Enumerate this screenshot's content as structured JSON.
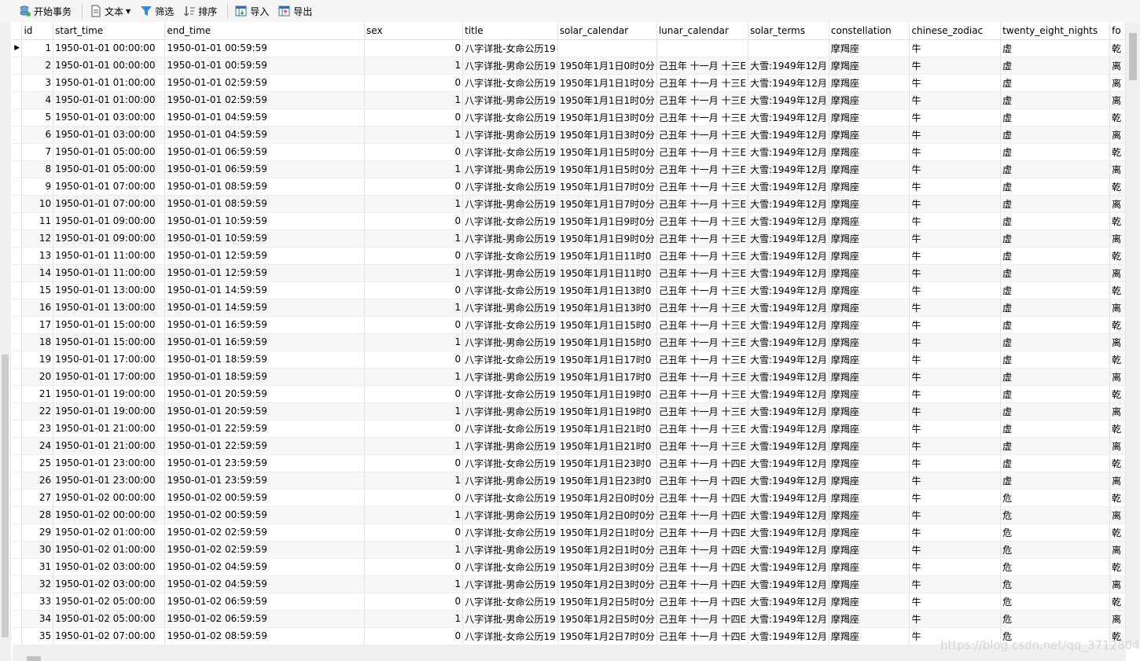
{
  "toolbar": {
    "begin_transaction": "开始事务",
    "text": "文本",
    "filter": "筛选",
    "sort": "排序",
    "import": "导入",
    "export": "导出"
  },
  "table": {
    "columns": [
      "id",
      "start_time",
      "end_time",
      "sex",
      "title",
      "solar_calendar",
      "lunar_calendar",
      "solar_terms",
      "constellation",
      "chinese_zodiac",
      "twenty_eight_nights",
      "fo"
    ],
    "rows": [
      [
        "1",
        "1950-01-01 00:00:00",
        "1950-01-01 00:59:59",
        "0",
        "八字详批-女命公历19",
        "",
        "",
        "",
        "摩羯座",
        "牛",
        "虚",
        "乾"
      ],
      [
        "2",
        "1950-01-01 00:00:00",
        "1950-01-01 00:59:59",
        "1",
        "八字详批-男命公历19",
        "1950年1月1日0时0分",
        "己丑年 十一月 十三E",
        "大雪:1949年12月",
        "摩羯座",
        "牛",
        "虚",
        "离"
      ],
      [
        "3",
        "1950-01-01 01:00:00",
        "1950-01-01 02:59:59",
        "0",
        "八字详批-女命公历19",
        "1950年1月1日1时0分",
        "己丑年 十一月 十三E",
        "大雪:1949年12月",
        "摩羯座",
        "牛",
        "虚",
        "离"
      ],
      [
        "4",
        "1950-01-01 01:00:00",
        "1950-01-01 02:59:59",
        "1",
        "八字详批-男命公历19",
        "1950年1月1日1时0分",
        "己丑年 十一月 十三E",
        "大雪:1949年12月",
        "摩羯座",
        "牛",
        "虚",
        "离"
      ],
      [
        "5",
        "1950-01-01 03:00:00",
        "1950-01-01 04:59:59",
        "0",
        "八字详批-女命公历19",
        "1950年1月1日3时0分",
        "己丑年 十一月 十三E",
        "大雪:1949年12月",
        "摩羯座",
        "牛",
        "虚",
        "乾"
      ],
      [
        "6",
        "1950-01-01 03:00:00",
        "1950-01-01 04:59:59",
        "1",
        "八字详批-男命公历19",
        "1950年1月1日3时0分",
        "己丑年 十一月 十三E",
        "大雪:1949年12月",
        "摩羯座",
        "牛",
        "虚",
        "离"
      ],
      [
        "7",
        "1950-01-01 05:00:00",
        "1950-01-01 06:59:59",
        "0",
        "八字详批-女命公历19",
        "1950年1月1日5时0分",
        "己丑年 十一月 十三E",
        "大雪:1949年12月",
        "摩羯座",
        "牛",
        "虚",
        "乾"
      ],
      [
        "8",
        "1950-01-01 05:00:00",
        "1950-01-01 06:59:59",
        "1",
        "八字详批-男命公历19",
        "1950年1月1日5时0分",
        "己丑年 十一月 十三E",
        "大雪:1949年12月",
        "摩羯座",
        "牛",
        "虚",
        "离"
      ],
      [
        "9",
        "1950-01-01 07:00:00",
        "1950-01-01 08:59:59",
        "0",
        "八字详批-女命公历19",
        "1950年1月1日7时0分",
        "己丑年 十一月 十三E",
        "大雪:1949年12月",
        "摩羯座",
        "牛",
        "虚",
        "乾"
      ],
      [
        "10",
        "1950-01-01 07:00:00",
        "1950-01-01 08:59:59",
        "1",
        "八字详批-男命公历19",
        "1950年1月1日7时0分",
        "己丑年 十一月 十三E",
        "大雪:1949年12月",
        "摩羯座",
        "牛",
        "虚",
        "离"
      ],
      [
        "11",
        "1950-01-01 09:00:00",
        "1950-01-01 10:59:59",
        "0",
        "八字详批-女命公历19",
        "1950年1月1日9时0分",
        "己丑年 十一月 十三E",
        "大雪:1949年12月",
        "摩羯座",
        "牛",
        "虚",
        "乾"
      ],
      [
        "12",
        "1950-01-01 09:00:00",
        "1950-01-01 10:59:59",
        "1",
        "八字详批-男命公历19",
        "1950年1月1日9时0分",
        "己丑年 十一月 十三E",
        "大雪:1949年12月",
        "摩羯座",
        "牛",
        "虚",
        "离"
      ],
      [
        "13",
        "1950-01-01 11:00:00",
        "1950-01-01 12:59:59",
        "0",
        "八字详批-女命公历19",
        "1950年1月1日11时0",
        "己丑年 十一月 十三E",
        "大雪:1949年12月",
        "摩羯座",
        "牛",
        "虚",
        "乾"
      ],
      [
        "14",
        "1950-01-01 11:00:00",
        "1950-01-01 12:59:59",
        "1",
        "八字详批-男命公历19",
        "1950年1月1日11时0",
        "己丑年 十一月 十三E",
        "大雪:1949年12月",
        "摩羯座",
        "牛",
        "虚",
        "离"
      ],
      [
        "15",
        "1950-01-01 13:00:00",
        "1950-01-01 14:59:59",
        "0",
        "八字详批-女命公历19",
        "1950年1月1日13时0",
        "己丑年 十一月 十三E",
        "大雪:1949年12月",
        "摩羯座",
        "牛",
        "虚",
        "乾"
      ],
      [
        "16",
        "1950-01-01 13:00:00",
        "1950-01-01 14:59:59",
        "1",
        "八字详批-男命公历19",
        "1950年1月1日13时0",
        "己丑年 十一月 十三E",
        "大雪:1949年12月",
        "摩羯座",
        "牛",
        "虚",
        "离"
      ],
      [
        "17",
        "1950-01-01 15:00:00",
        "1950-01-01 16:59:59",
        "0",
        "八字详批-女命公历19",
        "1950年1月1日15时0",
        "己丑年 十一月 十三E",
        "大雪:1949年12月",
        "摩羯座",
        "牛",
        "虚",
        "乾"
      ],
      [
        "18",
        "1950-01-01 15:00:00",
        "1950-01-01 16:59:59",
        "1",
        "八字详批-男命公历19",
        "1950年1月1日15时0",
        "己丑年 十一月 十三E",
        "大雪:1949年12月",
        "摩羯座",
        "牛",
        "虚",
        "离"
      ],
      [
        "19",
        "1950-01-01 17:00:00",
        "1950-01-01 18:59:59",
        "0",
        "八字详批-女命公历19",
        "1950年1月1日17时0",
        "己丑年 十一月 十三E",
        "大雪:1949年12月",
        "摩羯座",
        "牛",
        "虚",
        "乾"
      ],
      [
        "20",
        "1950-01-01 17:00:00",
        "1950-01-01 18:59:59",
        "1",
        "八字详批-男命公历19",
        "1950年1月1日17时0",
        "己丑年 十一月 十三E",
        "大雪:1949年12月",
        "摩羯座",
        "牛",
        "虚",
        "离"
      ],
      [
        "21",
        "1950-01-01 19:00:00",
        "1950-01-01 20:59:59",
        "0",
        "八字详批-女命公历19",
        "1950年1月1日19时0",
        "己丑年 十一月 十三E",
        "大雪:1949年12月",
        "摩羯座",
        "牛",
        "虚",
        "乾"
      ],
      [
        "22",
        "1950-01-01 19:00:00",
        "1950-01-01 20:59:59",
        "1",
        "八字详批-男命公历19",
        "1950年1月1日19时0",
        "己丑年 十一月 十三E",
        "大雪:1949年12月",
        "摩羯座",
        "牛",
        "虚",
        "离"
      ],
      [
        "23",
        "1950-01-01 21:00:00",
        "1950-01-01 22:59:59",
        "0",
        "八字详批-女命公历19",
        "1950年1月1日21时0",
        "己丑年 十一月 十三E",
        "大雪:1949年12月",
        "摩羯座",
        "牛",
        "虚",
        "乾"
      ],
      [
        "24",
        "1950-01-01 21:00:00",
        "1950-01-01 22:59:59",
        "1",
        "八字详批-男命公历19",
        "1950年1月1日21时0",
        "己丑年 十一月 十三E",
        "大雪:1949年12月",
        "摩羯座",
        "牛",
        "虚",
        "离"
      ],
      [
        "25",
        "1950-01-01 23:00:00",
        "1950-01-01 23:59:59",
        "0",
        "八字详批-女命公历19",
        "1950年1月1日23时0",
        "己丑年 十一月 十四E",
        "大雪:1949年12月",
        "摩羯座",
        "牛",
        "虚",
        "乾"
      ],
      [
        "26",
        "1950-01-01 23:00:00",
        "1950-01-01 23:59:59",
        "1",
        "八字详批-男命公历19",
        "1950年1月1日23时0",
        "己丑年 十一月 十四E",
        "大雪:1949年12月",
        "摩羯座",
        "牛",
        "虚",
        "离"
      ],
      [
        "27",
        "1950-01-02 00:00:00",
        "1950-01-02 00:59:59",
        "0",
        "八字详批-女命公历19",
        "1950年1月2日0时0分",
        "己丑年 十一月 十四E",
        "大雪:1949年12月",
        "摩羯座",
        "牛",
        "危",
        "乾"
      ],
      [
        "28",
        "1950-01-02 00:00:00",
        "1950-01-02 00:59:59",
        "1",
        "八字详批-男命公历19",
        "1950年1月2日0时0分",
        "己丑年 十一月 十四E",
        "大雪:1949年12月",
        "摩羯座",
        "牛",
        "危",
        "离"
      ],
      [
        "29",
        "1950-01-02 01:00:00",
        "1950-01-02 02:59:59",
        "0",
        "八字详批-女命公历19",
        "1950年1月2日1时0分",
        "己丑年 十一月 十四E",
        "大雪:1949年12月",
        "摩羯座",
        "牛",
        "危",
        "乾"
      ],
      [
        "30",
        "1950-01-02 01:00:00",
        "1950-01-02 02:59:59",
        "1",
        "八字详批-男命公历19",
        "1950年1月2日1时0分",
        "己丑年 十一月 十四E",
        "大雪:1949年12月",
        "摩羯座",
        "牛",
        "危",
        "离"
      ],
      [
        "31",
        "1950-01-02 03:00:00",
        "1950-01-02 04:59:59",
        "0",
        "八字详批-女命公历19",
        "1950年1月2日3时0分",
        "己丑年 十一月 十四E",
        "大雪:1949年12月",
        "摩羯座",
        "牛",
        "危",
        "乾"
      ],
      [
        "32",
        "1950-01-02 03:00:00",
        "1950-01-02 04:59:59",
        "1",
        "八字详批-男命公历19",
        "1950年1月2日3时0分",
        "己丑年 十一月 十四E",
        "大雪:1949年12月",
        "摩羯座",
        "牛",
        "危",
        "离"
      ],
      [
        "33",
        "1950-01-02 05:00:00",
        "1950-01-02 06:59:59",
        "0",
        "八字详批-女命公历19",
        "1950年1月2日5时0分",
        "己丑年 十一月 十四E",
        "大雪:1949年12月",
        "摩羯座",
        "牛",
        "危",
        "乾"
      ],
      [
        "34",
        "1950-01-02 05:00:00",
        "1950-01-02 06:59:59",
        "1",
        "八字详批-男命公历19",
        "1950年1月2日5时0分",
        "己丑年 十一月 十四E",
        "大雪:1949年12月",
        "摩羯座",
        "牛",
        "危",
        "离"
      ],
      [
        "35",
        "1950-01-02 07:00:00",
        "1950-01-02 08:59:59",
        "0",
        "八字详批-女命公历19",
        "1950年1月2日7时0分",
        "己丑年 十一月 十四E",
        "大雪:1949年12月",
        "摩羯座",
        "牛",
        "危",
        "乾"
      ]
    ]
  },
  "watermark": "https://blog.csdn.net/qq_37128049"
}
